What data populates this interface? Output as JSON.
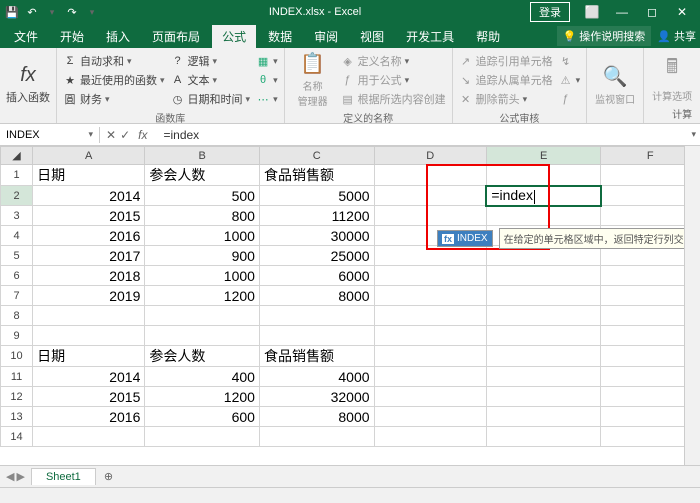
{
  "title": "INDEX.xlsx - Excel",
  "login": "登录",
  "menu": [
    "文件",
    "开始",
    "插入",
    "页面布局",
    "公式",
    "数据",
    "审阅",
    "视图",
    "开发工具",
    "帮助"
  ],
  "active_menu": 4,
  "tell_me": "操作说明搜索",
  "share": "共享",
  "ribbon": {
    "insert_fn": "插入函数",
    "lib": {
      "autosum": "自动求和",
      "recent": "最近使用的函数",
      "financial": "财务",
      "logical": "逻辑",
      "text": "文本",
      "datetime": "日期和时间",
      "label": "函数库"
    },
    "names": {
      "mgr": "名称\n管理器",
      "define": "定义名称",
      "use": "用于公式",
      "create": "根据所选内容创建",
      "label": "定义的名称"
    },
    "audit": {
      "precedents": "追踪引用单元格",
      "dependents": "追踪从属单元格",
      "remove": "删除箭头",
      "label": "公式审核"
    },
    "watch": "监视窗口",
    "calc": {
      "opts": "计算选项",
      "label": "计算"
    }
  },
  "namebox": "INDEX",
  "formula": "=index",
  "cols": [
    "A",
    "B",
    "C",
    "D",
    "E",
    "F"
  ],
  "rows14": true,
  "data": {
    "日期": "日期",
    "参会人数": "参会人数",
    "食品销售额": "食品销售额",
    "t1": [
      [
        2014,
        500,
        5000
      ],
      [
        2015,
        800,
        11200
      ],
      [
        2016,
        1000,
        30000
      ],
      [
        2017,
        900,
        25000
      ],
      [
        2018,
        1000,
        6000
      ],
      [
        2019,
        1200,
        8000
      ]
    ],
    "t2": [
      [
        2014,
        400,
        4000
      ],
      [
        2015,
        1200,
        32000
      ],
      [
        2016,
        600,
        8000
      ]
    ]
  },
  "cell_edit": "=index",
  "tooltip_fn": "INDEX",
  "tooltip_desc": "在给定的单元格区域中，返回特定行列交",
  "sheet_tab": "Sheet1"
}
